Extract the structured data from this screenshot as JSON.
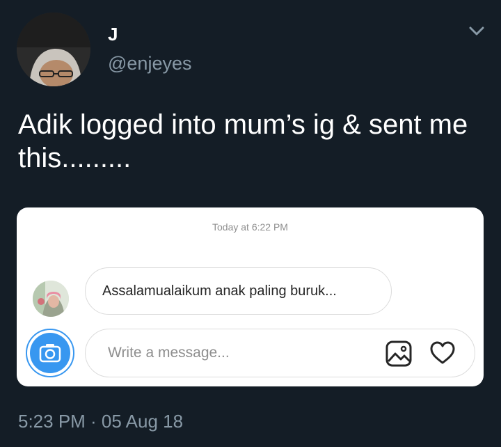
{
  "tweet": {
    "author": {
      "display_name": "J",
      "handle": "@enjeyes",
      "avatar_icon": "profile-photo"
    },
    "menu_icon": "chevron-down-icon",
    "text": "Adik logged into mum’s ig & sent me this.........",
    "timestamp": "5:23 PM · 05 Aug 18"
  },
  "dm_screenshot": {
    "timestamp": "Today at 6:22 PM",
    "message": {
      "text": "Assalamualaikum anak paling buruk...",
      "sender_avatar_icon": "sender-photo"
    },
    "composer": {
      "placeholder": "Write a message...",
      "camera_icon": "camera-icon",
      "gallery_icon": "gallery-icon",
      "like_icon": "heart-icon",
      "accent_color": "#3897f0"
    }
  },
  "colors": {
    "background": "#141d26",
    "secondary_text": "#8899a6",
    "card_background": "#ffffff"
  }
}
